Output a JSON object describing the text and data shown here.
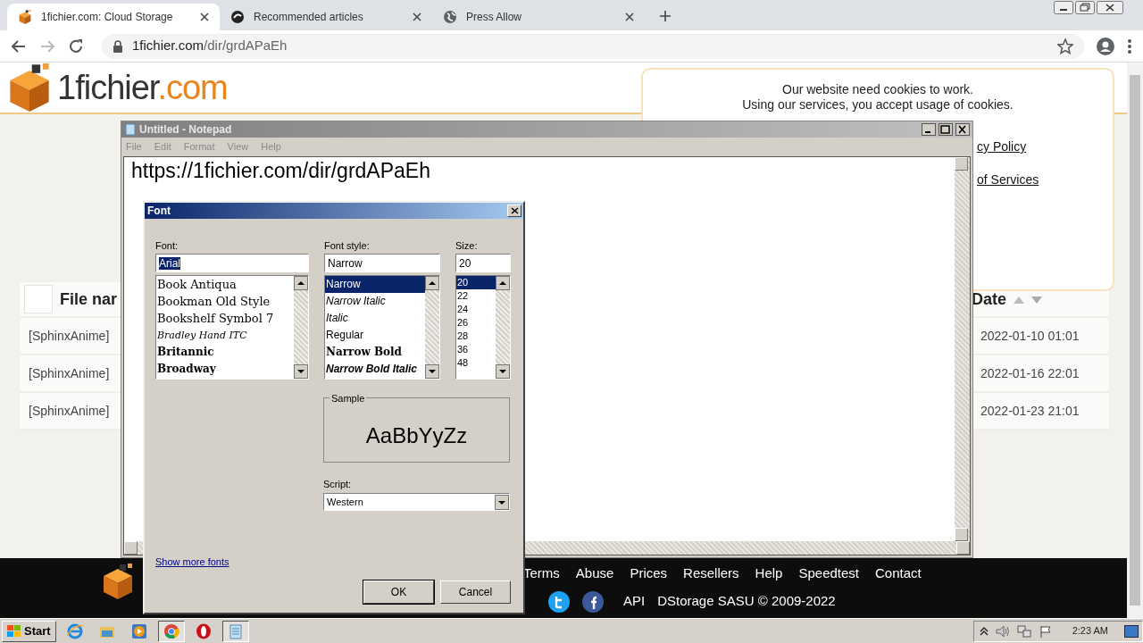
{
  "browser": {
    "tabs": [
      {
        "title": "1fichier.com: Cloud Storage",
        "selected": true,
        "kind": "cube"
      },
      {
        "title": "Recommended articles",
        "selected": false,
        "kind": "swirl"
      },
      {
        "title": "Press Allow",
        "selected": false,
        "kind": "globe"
      }
    ],
    "address": {
      "host": "1fichier.com",
      "path": "/dir/grdAPaEh"
    }
  },
  "site": {
    "logo": {
      "name": "1fichier",
      "suffix": ".com"
    },
    "cookie_notice": {
      "lines": [
        "Our website need cookies to work.",
        "Using our services, you accept usage of cookies."
      ],
      "links": [
        "cy Policy",
        "of Services"
      ]
    },
    "table": {
      "select_all": {
        "checked": false
      },
      "columns": [
        "File nar",
        "Date"
      ],
      "rows": [
        {
          "name": "[SphinxAnime]",
          "date": "2022-01-10 01:01"
        },
        {
          "name": "[SphinxAnime]",
          "date": "2022-01-16 22:01"
        },
        {
          "name": "[SphinxAnime]",
          "date": "2022-01-23 21:01"
        }
      ]
    },
    "footer": {
      "links": [
        "Terms",
        "Abuse",
        "Prices",
        "Resellers",
        "Help",
        "Speedtest",
        "Contact"
      ],
      "api": "API",
      "copyright": "DStorage SASU © 2009-2022"
    }
  },
  "notepad": {
    "title": "Untitled - Notepad",
    "menu": [
      "File",
      "Edit",
      "Format",
      "View",
      "Help"
    ],
    "text": "https://1fichier.com/dir/grdAPaEh"
  },
  "font_dialog": {
    "title": "Font",
    "font": {
      "label": "Font:",
      "value": "Arial",
      "items": [
        {
          "label": "Book Antiqua",
          "kind": "serif",
          "selected": false
        },
        {
          "label": "Bookman Old Style",
          "kind": "serif",
          "selected": false
        },
        {
          "label": "Bookshelf Symbol 7",
          "kind": "serif",
          "selected": false
        },
        {
          "label": "Bradley Hand ITC",
          "kind": "script",
          "selected": false
        },
        {
          "label": "Britannic",
          "kind": "bold",
          "selected": false
        },
        {
          "label": "Broadway",
          "kind": "bold",
          "selected": false
        }
      ]
    },
    "style": {
      "label": "Font style:",
      "value": "Narrow",
      "items": [
        {
          "label": "Narrow",
          "kind": "regular",
          "selected": true
        },
        {
          "label": "Narrow Italic",
          "kind": "italic",
          "selected": false
        },
        {
          "label": "Italic",
          "kind": "italic",
          "selected": false
        },
        {
          "label": "Regular",
          "kind": "regular",
          "selected": false
        },
        {
          "label": "Narrow Bold",
          "kind": "bold",
          "selected": false
        },
        {
          "label": "Narrow Bold Italic",
          "kind": "bold-italic",
          "selected": false
        }
      ]
    },
    "size": {
      "label": "Size:",
      "value": "20",
      "items": [
        {
          "label": "20",
          "selected": true
        },
        {
          "label": "22",
          "selected": false
        },
        {
          "label": "24",
          "selected": false
        },
        {
          "label": "26",
          "selected": false
        },
        {
          "label": "28",
          "selected": false
        },
        {
          "label": "36",
          "selected": false
        },
        {
          "label": "48",
          "selected": false
        }
      ]
    },
    "sample": {
      "label": "Sample",
      "text": "AaBbYyZz"
    },
    "script": {
      "label": "Script:",
      "value": "Western"
    },
    "more_link": "Show more fonts",
    "buttons": [
      "OK",
      "Cancel"
    ]
  },
  "taskbar": {
    "start": "Start",
    "apps": [
      {
        "kind": "ie",
        "active": false
      },
      {
        "kind": "folder",
        "active": false
      },
      {
        "kind": "media",
        "active": false
      },
      {
        "kind": "chrome",
        "active": true
      },
      {
        "kind": "opera",
        "active": false
      },
      {
        "kind": "notepad",
        "active": true
      }
    ],
    "clock": "2:23 AM"
  }
}
